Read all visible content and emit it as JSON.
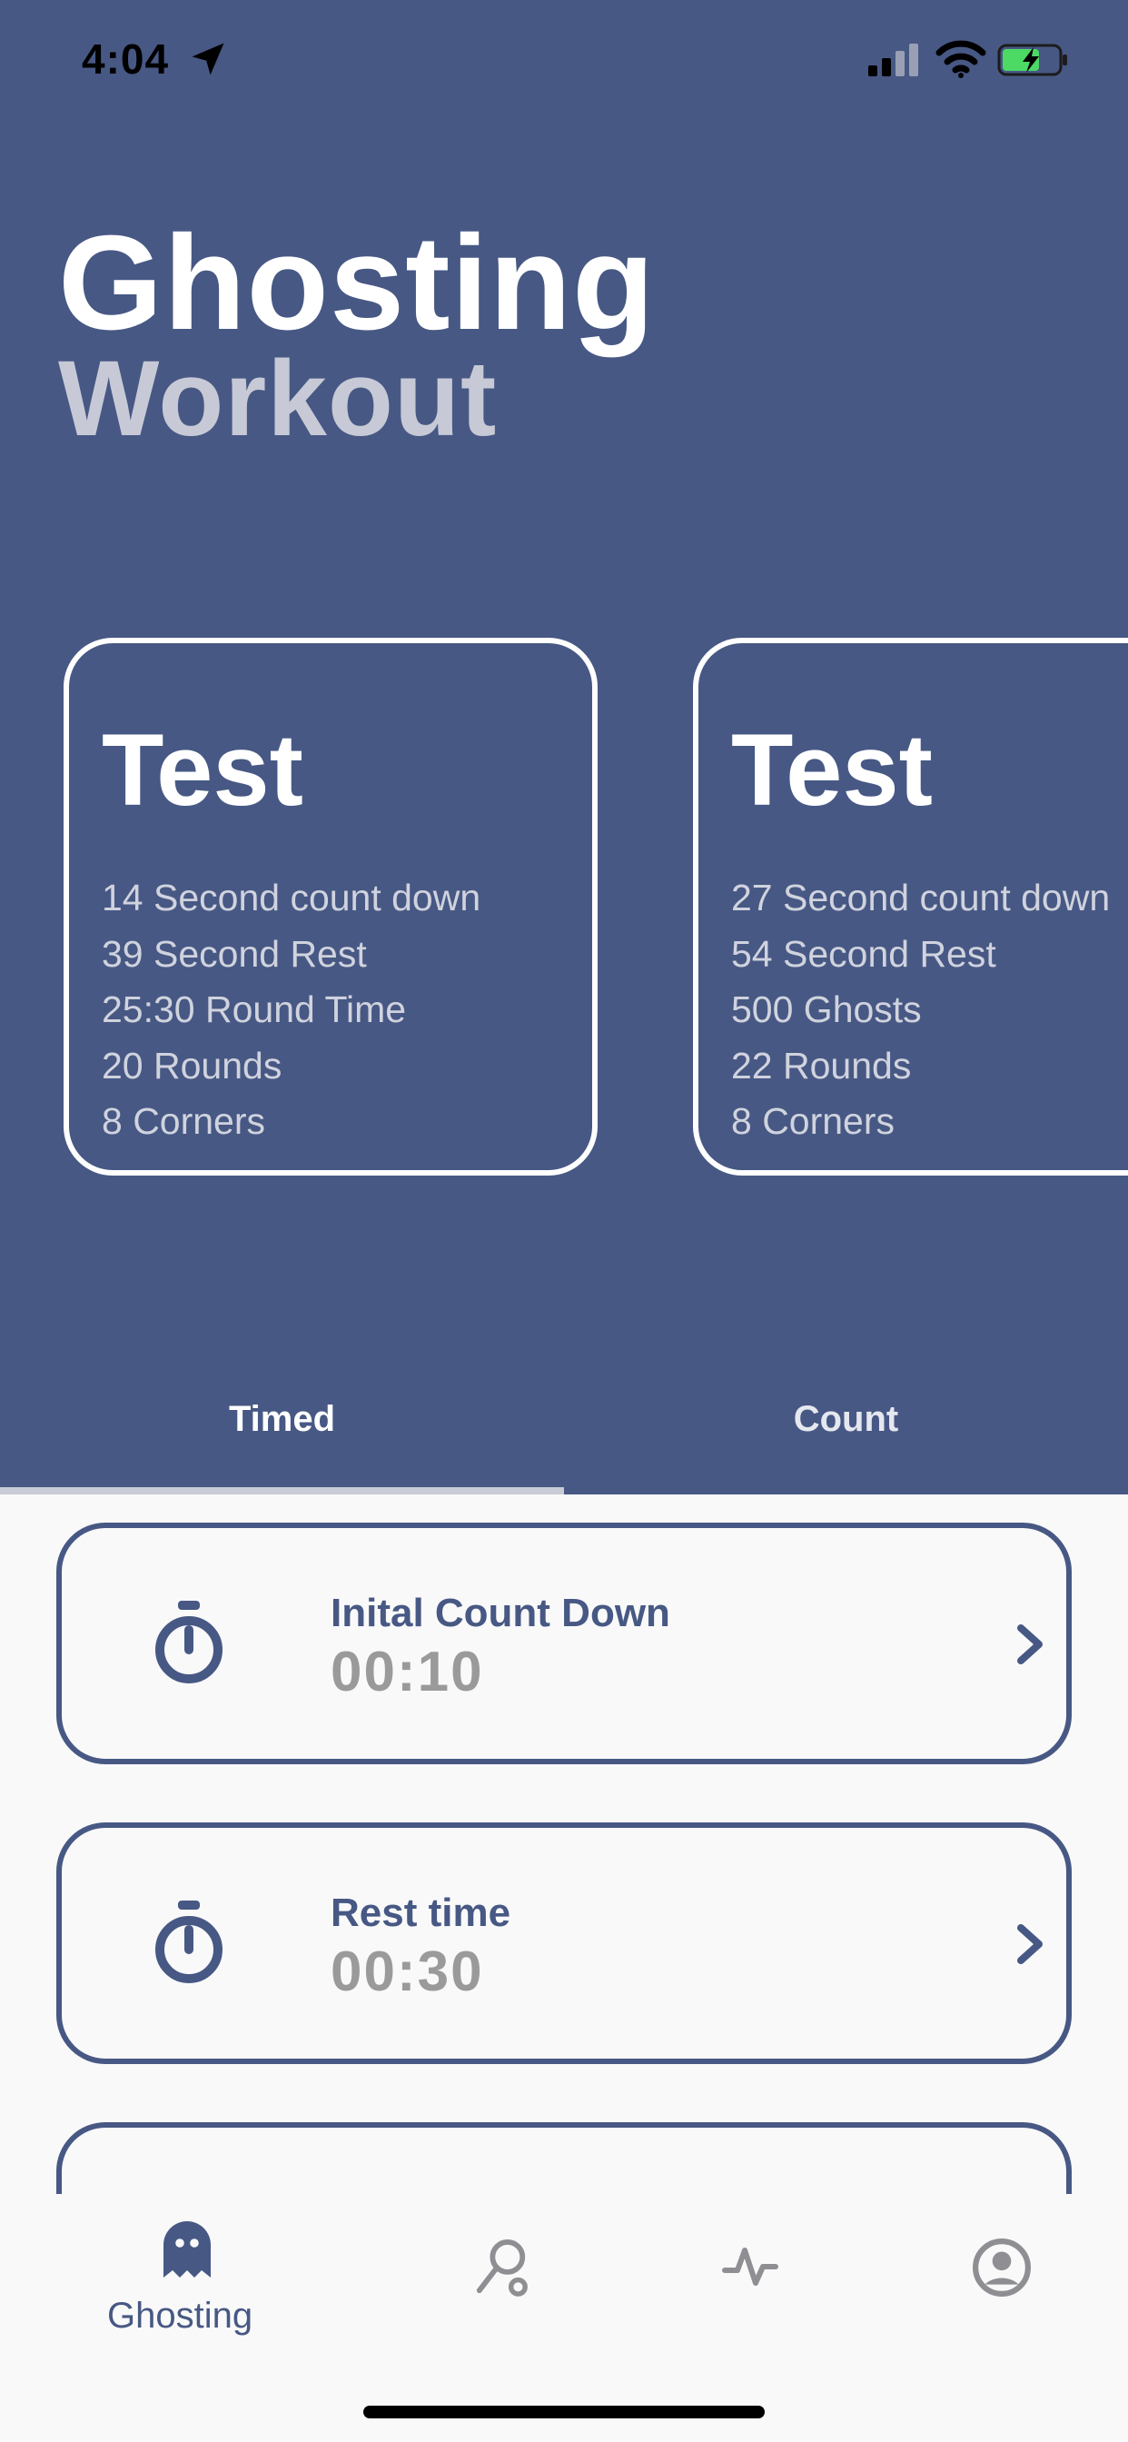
{
  "status_bar": {
    "time": "4:04"
  },
  "header": {
    "title_line1": "Ghosting",
    "title_line2": "Workout"
  },
  "cards": [
    {
      "title": "Test",
      "lines": [
        "14 Second count down",
        "39 Second Rest",
        "25:30 Round Time",
        "20 Rounds",
        "8 Corners"
      ]
    },
    {
      "title": "Test",
      "lines": [
        "27 Second count down",
        "54 Second Rest",
        "500 Ghosts",
        "22 Rounds",
        "8 Corners"
      ]
    }
  ],
  "tabs": [
    {
      "label": "Timed",
      "selected": true
    },
    {
      "label": "Count",
      "selected": false
    }
  ],
  "settings": [
    {
      "label": "Inital Count Down",
      "value": "00:10",
      "icon": "stopwatch-icon"
    },
    {
      "label": "Rest time",
      "value": "00:30",
      "icon": "stopwatch-icon"
    }
  ],
  "bottom_nav": {
    "items": [
      {
        "label": "Ghosting",
        "icon": "ghost-icon",
        "active": true
      },
      {
        "label": "",
        "icon": "search-icon",
        "active": false
      },
      {
        "label": "",
        "icon": "activity-icon",
        "active": false
      },
      {
        "label": "",
        "icon": "profile-icon",
        "active": false
      }
    ]
  },
  "colors": {
    "primary": "#475884",
    "background": "#F9F9F9",
    "muted_value": "#9A9A9A",
    "inactive_icon": "#8E8E93"
  }
}
